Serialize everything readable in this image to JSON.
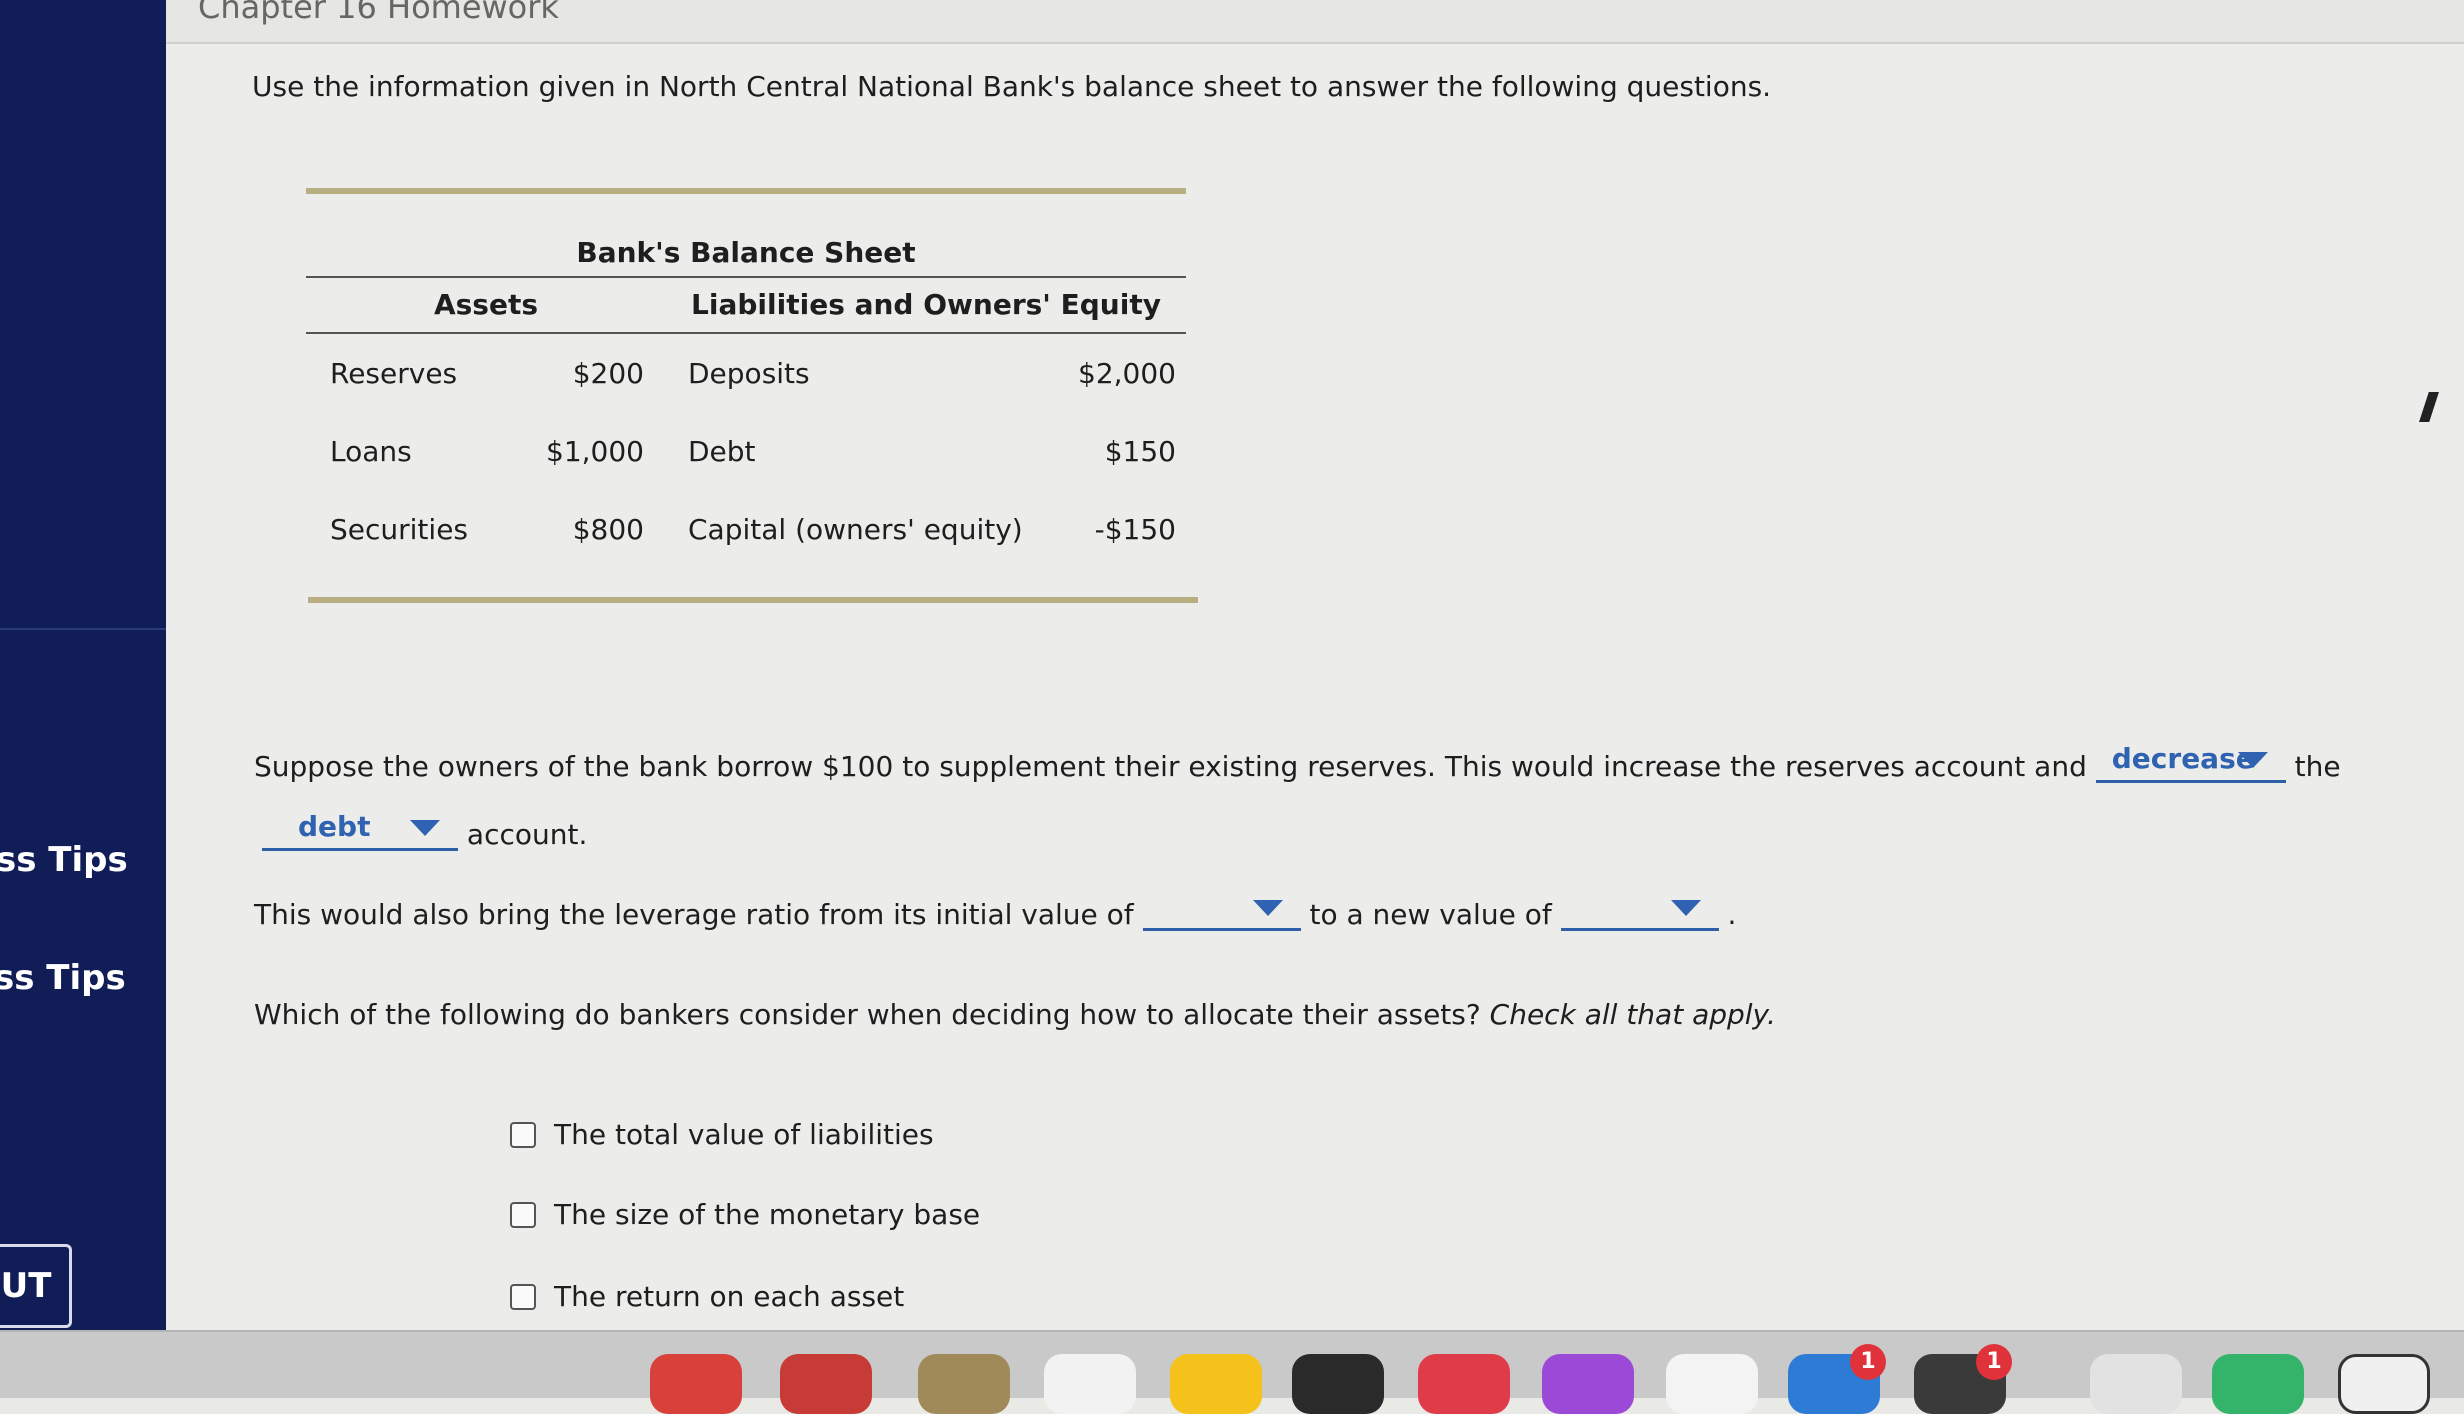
{
  "header": {
    "chapter_title": "Chapter 16 Homework"
  },
  "sidebar": {
    "items": [
      "ss Tips",
      "ss Tips"
    ],
    "button_label": "UT"
  },
  "intro_text": "Use the information given in North Central National Bank's balance sheet to answer the following questions.",
  "balance_sheet": {
    "title": "Bank's Balance Sheet",
    "headers": {
      "assets": "Assets",
      "liabilities": "Liabilities and Owners' Equity"
    },
    "rows": [
      {
        "asset": "Reserves",
        "asset_value": "$200",
        "liability": "Deposits",
        "liability_value": "$2,000"
      },
      {
        "asset": "Loans",
        "asset_value": "$1,000",
        "liability": "Debt",
        "liability_value": "$150"
      },
      {
        "asset": "Securities",
        "asset_value": "$800",
        "liability": "Capital (owners' equity)",
        "liability_value": "-$150"
      }
    ]
  },
  "question1": {
    "part_a": "Suppose the owners of the bank borrow $100 to supplement their existing reserves. This would increase the reserves account and",
    "dropdown1_value": "decrease",
    "part_b": "the",
    "dropdown2_value": "debt",
    "part_c": "account."
  },
  "question2": {
    "part_a": "This would also bring the leverage ratio from its initial value of",
    "dropdown1_value": "",
    "part_b": "to a new value of",
    "dropdown2_value": "",
    "part_c": "."
  },
  "question3": {
    "prompt": "Which of the following do bankers consider when deciding how to allocate their assets?",
    "instruction": "Check all that apply.",
    "options": [
      "The total value of liabilities",
      "The size of the monetary base",
      "The return on each asset"
    ]
  },
  "dock": {
    "badges": [
      "1",
      "1"
    ]
  },
  "colors": {
    "sidebar": "#101d57",
    "accent": "#2f62b0",
    "rule": "#b7ae82"
  }
}
